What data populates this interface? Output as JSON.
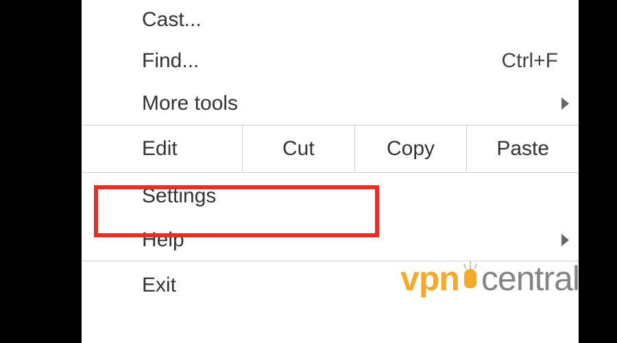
{
  "menu": {
    "cast_label": "Cast...",
    "find_label": "Find...",
    "find_shortcut": "Ctrl+F",
    "more_tools_label": "More tools",
    "edit_label": "Edit",
    "cut_label": "Cut",
    "copy_label": "Copy",
    "paste_label": "Paste",
    "settings_label": "Settings",
    "help_label": "Help",
    "exit_label": "Exit"
  },
  "highlight": {
    "target": "settings"
  },
  "watermark": {
    "part1": "vpn",
    "part2": "central"
  }
}
